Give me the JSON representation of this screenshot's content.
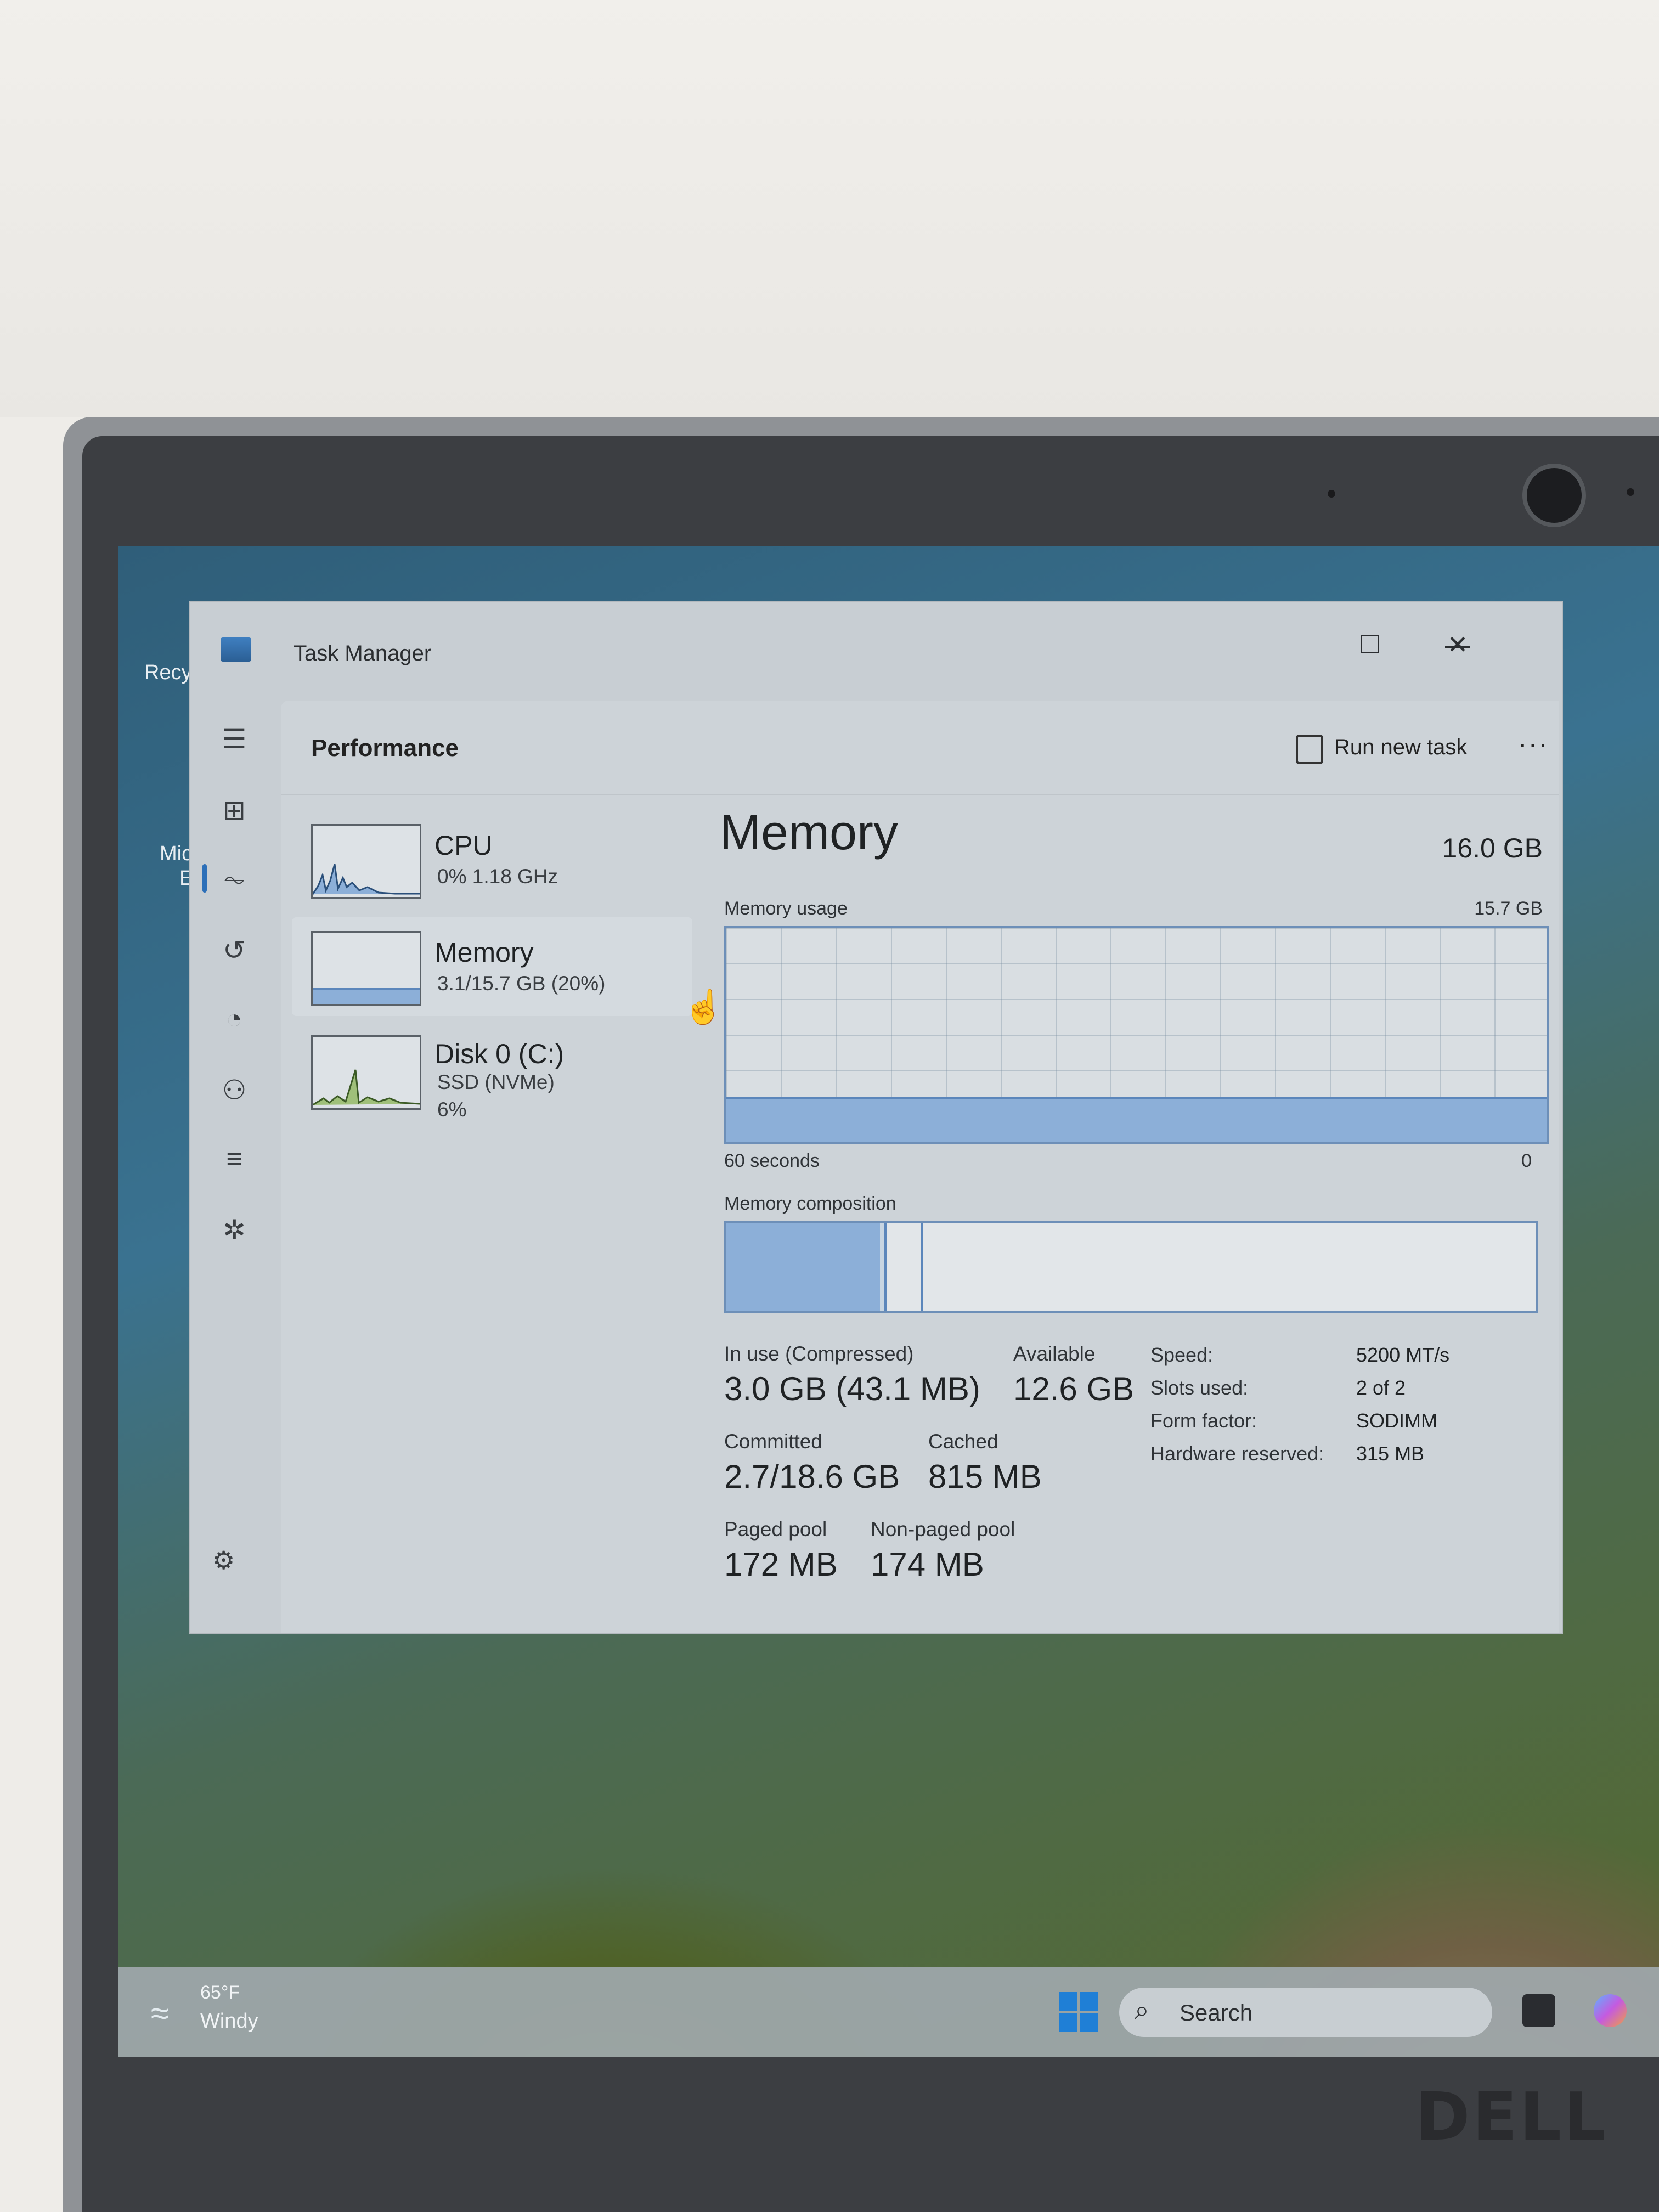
{
  "window": {
    "title": "Task Manager",
    "minimize_glyph": "—",
    "maximize_glyph": "☐",
    "close_glyph": "✕"
  },
  "desktop": {
    "icons": [
      "Recy",
      "Mic",
      "E"
    ]
  },
  "header": {
    "page_title": "Performance",
    "run_new_task": "Run new task",
    "more_glyph": "···"
  },
  "nav": {
    "icons": [
      "hamburger-icon",
      "processes-icon",
      "performance-icon",
      "app-history-icon",
      "startup-apps-icon",
      "users-icon",
      "details-icon",
      "services-icon",
      "settings-icon"
    ]
  },
  "resources": [
    {
      "name": "CPU",
      "sub1": "0% 1.18 GHz",
      "sub2": ""
    },
    {
      "name": "Memory",
      "sub1": "3.1/15.7 GB (20%)",
      "sub2": ""
    },
    {
      "name": "Disk 0 (C:)",
      "sub1": "SSD (NVMe)",
      "sub2": "6%"
    }
  ],
  "memory": {
    "title": "Memory",
    "total": "16.0 GB",
    "usage_label": "Memory usage",
    "usage_max": "15.7 GB",
    "usage_fraction": 0.2,
    "axis_left": "60 seconds",
    "axis_right": "0",
    "composition_label": "Memory composition",
    "composition": {
      "in_use_fraction": 0.19,
      "modified_fraction": 0.005,
      "standby_fraction": 0.045
    },
    "stats": {
      "in_use_label": "In use (Compressed)",
      "in_use_value": "3.0 GB (43.1 MB)",
      "available_label": "Available",
      "available_value": "12.6 GB",
      "committed_label": "Committed",
      "committed_value": "2.7/18.6 GB",
      "cached_label": "Cached",
      "cached_value": "815 MB",
      "paged_label": "Paged pool",
      "paged_value": "172 MB",
      "nonpaged_label": "Non-paged pool",
      "nonpaged_value": "174 MB"
    },
    "specs": {
      "speed_label": "Speed:",
      "speed_value": "5200 MT/s",
      "slots_label": "Slots used:",
      "slots_value": "2 of 2",
      "form_label": "Form factor:",
      "form_value": "SODIMM",
      "hw_label": "Hardware reserved:",
      "hw_value": "315 MB"
    }
  },
  "taskbar": {
    "weather_temp": "65°F",
    "weather_cond": "Windy",
    "search_placeholder": "Search"
  },
  "brand": "DELL",
  "colors": {
    "accent": "#2c6fb8",
    "graph_fill": "#8cafd8",
    "graph_border": "#6d8fb8"
  }
}
